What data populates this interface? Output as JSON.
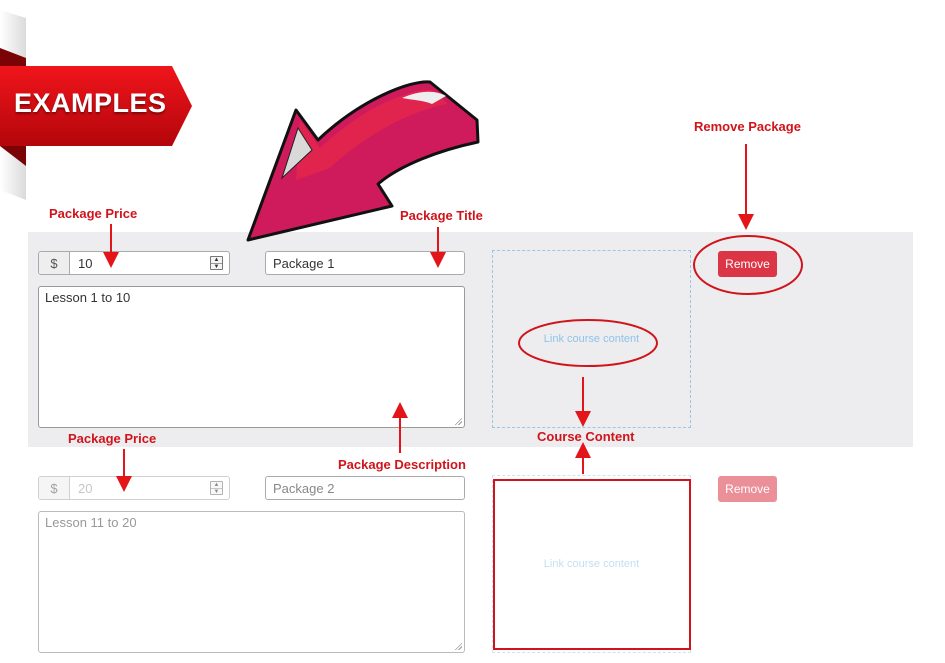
{
  "banner": {
    "label": "EXAMPLES"
  },
  "annotations": {
    "package_price_1": "Package Price",
    "package_title": "Package Title",
    "remove_package": "Remove Package",
    "package_price_2": "Package Price",
    "package_description": "Package Description",
    "course_content": "Course Content"
  },
  "packages": [
    {
      "currency": "$",
      "price": "10",
      "title": "Package 1",
      "description": "Lesson 1 to 10",
      "link_label": "Link course content",
      "remove_label": "Remove"
    },
    {
      "currency": "$",
      "price": "20",
      "title": "Package 2",
      "description": "Lesson 11 to 20",
      "link_label": "Link course content",
      "remove_label": "Remove"
    }
  ],
  "colors": {
    "annotation_red": "#d0141b",
    "remove_button": "#dc3545",
    "link_dashed": "#9cc6e6",
    "panel_bg": "#ededef"
  }
}
